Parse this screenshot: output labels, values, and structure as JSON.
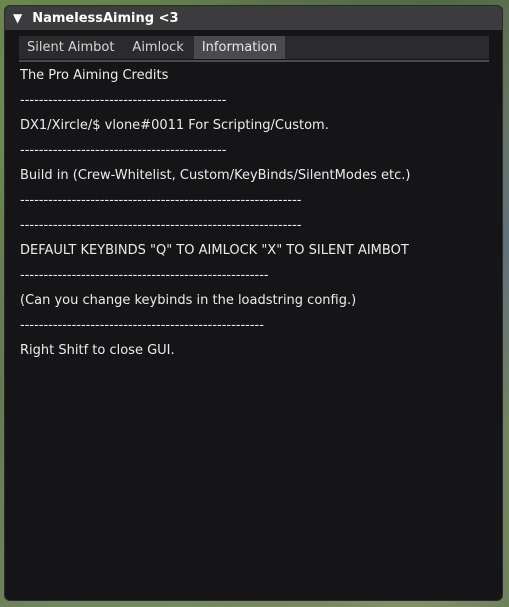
{
  "window": {
    "title": "NamelessAiming <3",
    "collapse_glyph": "▼"
  },
  "tabs": [
    {
      "label": "Silent Aimbot",
      "active": false
    },
    {
      "label": "Aimlock",
      "active": false
    },
    {
      "label": "Information",
      "active": true
    }
  ],
  "info_lines": [
    "The Pro Aiming Credits",
    "--------------------------------------------",
    "DX1/Xircle/$ vlone#0011 For Scripting/Custom.",
    "--------------------------------------------",
    "Build in (Crew-Whitelist, Custom/KeyBinds/SilentModes etc.)",
    "------------------------------------------------------------",
    "------------------------------------------------------------",
    "DEFAULT KEYBINDS \"Q\" TO AIMLOCK \"X\" TO SILENT AIMBOT",
    "-----------------------------------------------------",
    "(Can you change keybinds in the loadstring config.)",
    "----------------------------------------------------",
    "Right Shitf to close GUI."
  ],
  "colors": {
    "titlebar": "#3c3c3f",
    "panel": "#151517",
    "tab_active": "#4a4a4e",
    "text": "#ececec"
  }
}
